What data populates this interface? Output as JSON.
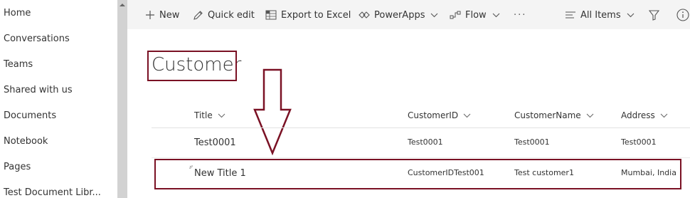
{
  "nav": {
    "items": [
      {
        "label": "Home"
      },
      {
        "label": "Conversations"
      },
      {
        "label": "Teams"
      },
      {
        "label": "Shared with us"
      },
      {
        "label": "Documents"
      },
      {
        "label": "Notebook"
      },
      {
        "label": "Pages"
      },
      {
        "label": "Test Document Libr..."
      }
    ]
  },
  "commandbar": {
    "new": {
      "label": "New",
      "icon": "plus-icon"
    },
    "quick_edit": {
      "label": "Quick edit",
      "icon": "pencil-icon"
    },
    "export": {
      "label": "Export to Excel",
      "icon": "excel-icon"
    },
    "powerapps": {
      "label": "PowerApps",
      "icon": "powerapps-icon"
    },
    "flow": {
      "label": "Flow",
      "icon": "flow-icon"
    },
    "more": {
      "label": "···",
      "icon": "more-icon"
    },
    "view": {
      "label": "All Items",
      "icon": "list-view-icon"
    },
    "filter": {
      "icon": "filter-icon"
    },
    "info": {
      "icon": "info-icon"
    }
  },
  "list": {
    "title": "Customer",
    "columns": [
      {
        "key": "title",
        "label": "Title"
      },
      {
        "key": "customer_id",
        "label": "CustomerID"
      },
      {
        "key": "customer_name",
        "label": "CustomerName"
      },
      {
        "key": "address",
        "label": "Address"
      }
    ],
    "rows": [
      {
        "title": "Test0001",
        "customer_id": "Test0001",
        "customer_name": "Test0001",
        "address": "Test0001"
      },
      {
        "title": "New Title 1",
        "customer_id": "CustomerIDTest001",
        "customer_name": "Test customer1",
        "address": "Mumbai, India"
      }
    ]
  },
  "colors": {
    "annotation": "#7a1124",
    "commandbar_bg": "#f4f4f4",
    "text": "#333333"
  }
}
